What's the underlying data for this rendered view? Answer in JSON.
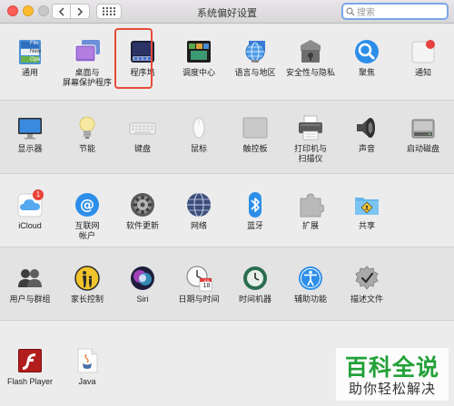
{
  "window": {
    "title": "系统偏好设置",
    "search_placeholder": "搜索"
  },
  "rows": [
    [
      {
        "label": "通用",
        "icon": "general-icon"
      },
      {
        "label": "桌面与\n屏幕保护程序",
        "icon": "desktop-icon"
      },
      {
        "label": "程序坞",
        "icon": "dock-icon",
        "highlighted": true
      },
      {
        "label": "调度中心",
        "icon": "mission-control-icon"
      },
      {
        "label": "语言与地区",
        "icon": "language-icon"
      },
      {
        "label": "安全性与隐私",
        "icon": "security-icon"
      },
      {
        "label": "聚焦",
        "icon": "spotlight-icon"
      },
      {
        "label": "通知",
        "icon": "notifications-icon"
      }
    ],
    [
      {
        "label": "显示器",
        "icon": "displays-icon"
      },
      {
        "label": "节能",
        "icon": "energy-saver-icon"
      },
      {
        "label": "键盘",
        "icon": "keyboard-icon"
      },
      {
        "label": "鼠标",
        "icon": "mouse-icon"
      },
      {
        "label": "触控板",
        "icon": "trackpad-icon"
      },
      {
        "label": "打印机与\n扫描仪",
        "icon": "printer-icon"
      },
      {
        "label": "声音",
        "icon": "sound-icon"
      },
      {
        "label": "启动磁盘",
        "icon": "startup-disk-icon"
      }
    ],
    [
      {
        "label": "iCloud",
        "icon": "icloud-icon",
        "badge": "1"
      },
      {
        "label": "互联网\n帐户",
        "icon": "internet-accounts-icon"
      },
      {
        "label": "软件更新",
        "icon": "software-update-icon"
      },
      {
        "label": "网络",
        "icon": "network-icon"
      },
      {
        "label": "蓝牙",
        "icon": "bluetooth-icon"
      },
      {
        "label": "扩展",
        "icon": "extensions-icon"
      },
      {
        "label": "共享",
        "icon": "sharing-icon"
      }
    ],
    [
      {
        "label": "用户与群组",
        "icon": "users-icon"
      },
      {
        "label": "家长控制",
        "icon": "parental-controls-icon"
      },
      {
        "label": "Siri",
        "icon": "siri-icon"
      },
      {
        "label": "日期与时间",
        "icon": "date-time-icon"
      },
      {
        "label": "时间机器",
        "icon": "time-machine-icon"
      },
      {
        "label": "辅助功能",
        "icon": "accessibility-icon"
      },
      {
        "label": "描述文件",
        "icon": "profiles-icon"
      }
    ],
    [
      {
        "label": "Flash Player",
        "icon": "flash-icon"
      },
      {
        "label": "Java",
        "icon": "java-icon"
      }
    ]
  ],
  "icon_texts": {
    "general_file": "File",
    "general_new": "New",
    "general_open": "Ope",
    "calendar_month": "JUL",
    "calendar_day": "18"
  },
  "watermark": {
    "line1": "百科全说",
    "line2": "助你轻松解决"
  },
  "colors": {
    "highlight": "#e84b3a",
    "watermark_green": "#21a137"
  }
}
